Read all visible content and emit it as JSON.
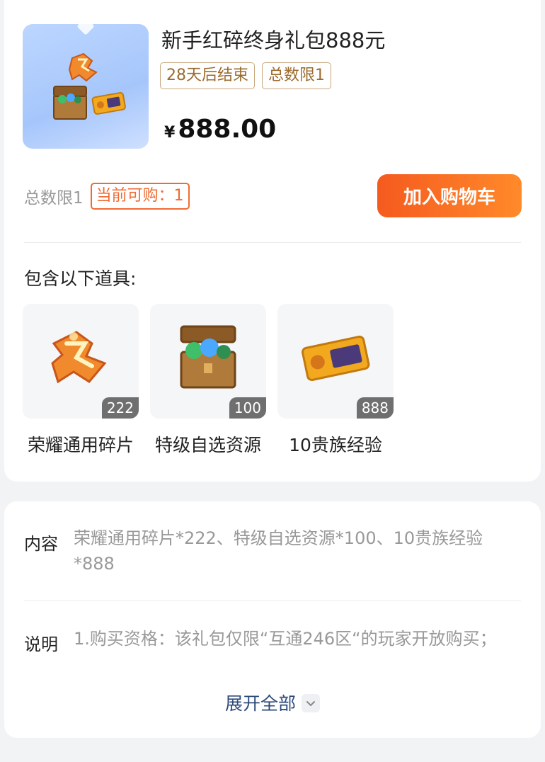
{
  "product": {
    "title": "新手红碎终身礼包888元",
    "tags": [
      "28天后结束",
      "总数限1"
    ],
    "currency": "¥",
    "price": "888.00",
    "total_limit": "总数限1",
    "purchasable": "当前可购：1",
    "cart_button": "加入购物车"
  },
  "items_section": {
    "title": "包含以下道具:",
    "items": [
      {
        "name": "荣耀通用碎片",
        "count": "222",
        "icon": "glory-fragment-icon"
      },
      {
        "name": "特级自选资源",
        "count": "100",
        "icon": "resource-chest-icon"
      },
      {
        "name": "10贵族经验",
        "count": "888",
        "icon": "noble-exp-card-icon"
      }
    ]
  },
  "details": {
    "content_label": "内容",
    "content_text": "荣耀通用碎片*222、特级自选资源*100、10贵族经验*888",
    "desc_label": "说明",
    "desc_text": "1.购买资格：该礼包仅限“互通246区“的玩家开放购买；",
    "expand_label": "展开全部"
  },
  "colors": {
    "accent": "#f55a1f",
    "tag_border": "#c7a67b",
    "link": "#2d4a7a"
  }
}
